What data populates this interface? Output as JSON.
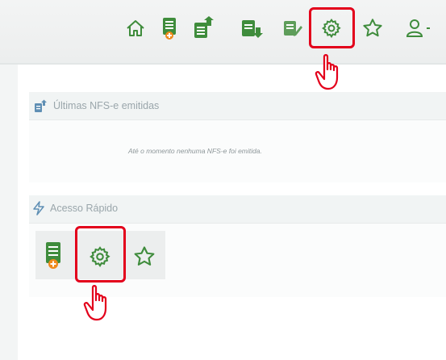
{
  "toolbar": {
    "icons": [
      "home-icon",
      "new-invoice-icon",
      "export-icon",
      "import-icon",
      "edit-icon",
      "gear-icon",
      "star-icon",
      "user-icon"
    ],
    "highlighted": "gear-icon",
    "accent_color": "#3f8c3c",
    "highlight_color": "#e3001b"
  },
  "latest_panel": {
    "title": "Últimas NFS-e emitidas",
    "empty_message": "Até o momento nenhuma NFS-e foi emitida."
  },
  "quick_access": {
    "title": "Acesso Rápido",
    "icons": [
      "new-invoice-icon",
      "gear-icon",
      "star-icon"
    ],
    "highlighted": "gear-icon"
  }
}
